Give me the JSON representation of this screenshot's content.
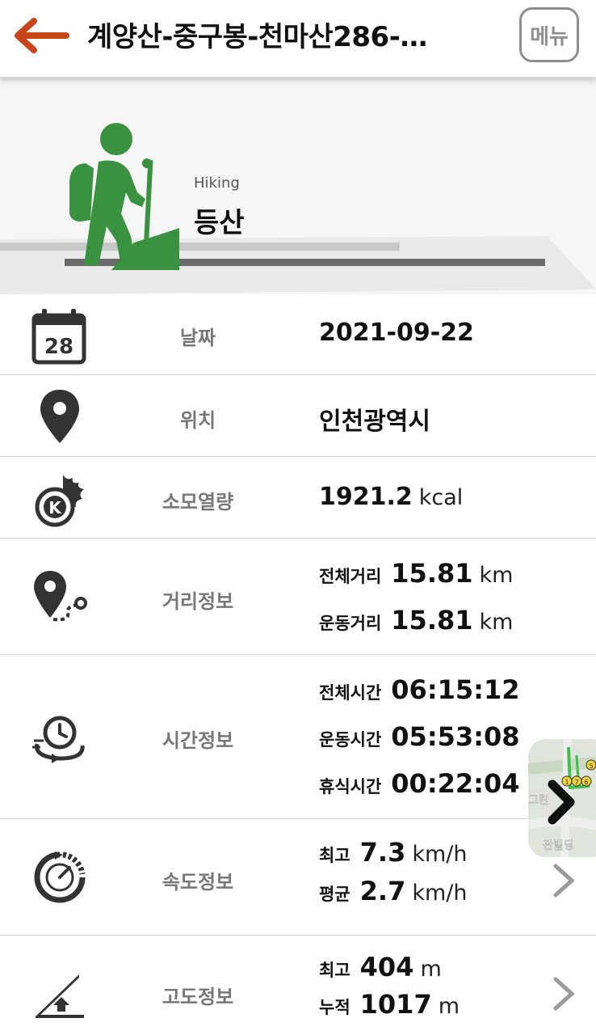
{
  "header": {
    "title": "계양산-중구봉-천마산286-…",
    "menu_label": "메뉴"
  },
  "activity": {
    "subtitle": "Hiking",
    "title": "등산"
  },
  "rows": {
    "date": {
      "label": "날짜",
      "value": "2021-09-22",
      "icon_day": "28"
    },
    "location": {
      "label": "위치",
      "value": "인천광역시"
    },
    "calories": {
      "label": "소모열량",
      "value": "1921.2",
      "unit": "kcal"
    },
    "distance": {
      "label": "거리정보",
      "total_label": "전체거리",
      "total_value": "15.81",
      "total_unit": "km",
      "moving_label": "운동거리",
      "moving_value": "15.81",
      "moving_unit": "km"
    },
    "time": {
      "label": "시간정보",
      "total_label": "전체시간",
      "total_value": "06:15:12",
      "moving_label": "운동시간",
      "moving_value": "05:53:08",
      "rest_label": "휴식시간",
      "rest_value": "00:22:04"
    },
    "speed": {
      "label": "속도정보",
      "max_label": "최고",
      "max_value": "7.3",
      "max_unit": "km/h",
      "avg_label": "평균",
      "avg_value": "2.7",
      "avg_unit": "km/h"
    },
    "altitude": {
      "label": "고도정보",
      "max_label": "최고",
      "max_value": "404",
      "max_unit": "m",
      "cum_label": "누적",
      "cum_value": "1017",
      "cum_unit": "m"
    }
  },
  "map_thumb": {
    "text_left": "그린",
    "text_bottom": "관빌딩",
    "markers": [
      "1",
      "7",
      "6",
      "5"
    ]
  },
  "colors": {
    "accent_back": "#c9461a",
    "hiking_green": "#3a913f",
    "icon_dark": "#333333"
  }
}
